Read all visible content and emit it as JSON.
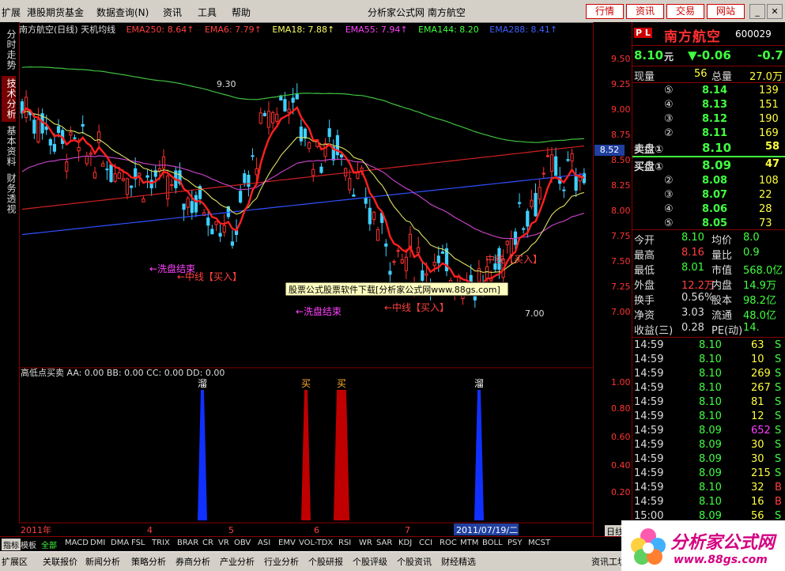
{
  "menu": {
    "items": [
      "扩展",
      "港股期货基金",
      "数据查询(N)",
      "资讯",
      "工具",
      "帮助"
    ],
    "title": "分析家公式网  南方航空",
    "buttons": [
      "行情",
      "资讯",
      "交易",
      "网站"
    ]
  },
  "side_tabs": [
    "分时走势",
    "技术分析",
    "基本资料",
    "财务透视"
  ],
  "indicator_line": {
    "prefix": "南方航空(日线) 天机均线",
    "emas": [
      {
        "label": "EMA250: 8.64↑",
        "color": "#ff4040"
      },
      {
        "label": "EMA6: 7.79↑",
        "color": "#ff4040"
      },
      {
        "label": "EMA18: 7.88↑",
        "color": "#ffff60"
      },
      {
        "label": "EMA55: 7.94↑",
        "color": "#ff40ff"
      },
      {
        "label": "EMA144: 8.20",
        "color": "#40ff40"
      },
      {
        "label": "EMA288: 8.41↑",
        "color": "#4060ff"
      }
    ]
  },
  "price_axis": [
    "9.50",
    "9.25",
    "9.00",
    "8.75",
    "8.50",
    "8.25",
    "8.00",
    "7.75",
    "7.50",
    "7.25",
    "7.00"
  ],
  "current_price_tag": "8.52",
  "annotations": {
    "high": "9.30",
    "low": "7.00",
    "wash1": "←洗盘结束",
    "wash2": "←洗盘结束",
    "buy1": "←中线【买入】",
    "buy2": "←中线【买入】",
    "buy3": "中线【买入】",
    "watermark": "股票公式股票软件下载[分析家公式网www.88gs.com]"
  },
  "lower_panel": {
    "title": "高低点买卖 AA: 0.00 BB: 0.00 CC: 0.00 DD: 0.00",
    "axis": [
      "1.00",
      "0.80",
      "0.60",
      "0.40",
      "0.20"
    ],
    "signals": [
      "溜",
      "买",
      "买",
      "溜"
    ]
  },
  "chart_data": {
    "type": "bar",
    "x_labels": [
      "2011年",
      "4",
      "5",
      "6",
      "7",
      "2011/07/19/二"
    ],
    "signal_bars": [
      {
        "label": "溜",
        "value": 1.0,
        "color": "#1030ff"
      },
      {
        "label": "买",
        "value": 1.0,
        "color": "#c00000"
      },
      {
        "label": "买",
        "value": 1.0,
        "color": "#c00000"
      },
      {
        "label": "溜",
        "value": 1.0,
        "color": "#1030ff"
      }
    ],
    "ylim": [
      0,
      1.0
    ]
  },
  "right_panel": {
    "logo": "P L",
    "name": "南方航空",
    "code": "600029",
    "price": "8.10",
    "price_unit": "元",
    "change": "▼-0.06",
    "change2": "-0.7",
    "volume_now_label": "现量",
    "volume_now": "56",
    "volume_total_label": "总量",
    "volume_total": "27.0万",
    "sell_levels": [
      {
        "lvl": "⑤",
        "price": "8.14",
        "vol": "139"
      },
      {
        "lvl": "④",
        "price": "8.13",
        "vol": "151"
      },
      {
        "lvl": "③",
        "price": "8.12",
        "vol": "190"
      },
      {
        "lvl": "②",
        "price": "8.11",
        "vol": "169"
      }
    ],
    "ask1": {
      "label": "卖盘①",
      "price": "8.10",
      "vol": "58"
    },
    "bid1": {
      "label": "买盘①",
      "price": "8.09",
      "vol": "47"
    },
    "buy_levels": [
      {
        "lvl": "②",
        "price": "8.08",
        "vol": "108"
      },
      {
        "lvl": "③",
        "price": "8.07",
        "vol": "22"
      },
      {
        "lvl": "④",
        "price": "8.06",
        "vol": "28"
      },
      {
        "lvl": "⑤",
        "price": "8.05",
        "vol": "73"
      }
    ],
    "stats": [
      {
        "a": "今开",
        "b": "8.10",
        "c": "均价",
        "d": "8.0"
      },
      {
        "a": "最高",
        "b": "8.16",
        "c": "量比",
        "d": "0.9"
      },
      {
        "a": "最低",
        "b": "8.01",
        "c": "市值",
        "d": "568.0亿"
      },
      {
        "a": "外盘",
        "b": "12.2万",
        "c": "内盘",
        "d": "14.9万"
      },
      {
        "a": "换手",
        "b": "0.56%",
        "c": "股本",
        "d": "98.2亿"
      },
      {
        "a": "净资",
        "b": "3.03",
        "c": "流通",
        "d": "48.0亿"
      },
      {
        "a": "收益(三)",
        "b": "0.28",
        "c": "PE(动)",
        "d": "14."
      }
    ],
    "ticks": [
      {
        "t": "14:59",
        "p": "8.10",
        "v": "63",
        "s": "S"
      },
      {
        "t": "14:59",
        "p": "8.10",
        "v": "10",
        "s": "S"
      },
      {
        "t": "14:59",
        "p": "8.10",
        "v": "269",
        "s": "S"
      },
      {
        "t": "14:59",
        "p": "8.10",
        "v": "267",
        "s": "S"
      },
      {
        "t": "14:59",
        "p": "8.10",
        "v": "81",
        "s": "S"
      },
      {
        "t": "14:59",
        "p": "8.10",
        "v": "12",
        "s": "S"
      },
      {
        "t": "14:59",
        "p": "8.09",
        "v": "652",
        "s": "S"
      },
      {
        "t": "14:59",
        "p": "8.09",
        "v": "30",
        "s": "S"
      },
      {
        "t": "14:59",
        "p": "8.09",
        "v": "30",
        "s": "S"
      },
      {
        "t": "14:59",
        "p": "8.09",
        "v": "215",
        "s": "S"
      },
      {
        "t": "14:59",
        "p": "8.10",
        "v": "32",
        "s": "B"
      },
      {
        "t": "14:59",
        "p": "8.10",
        "v": "16",
        "s": "B"
      },
      {
        "t": "15:00",
        "p": "8.09",
        "v": "56",
        "s": "S"
      }
    ]
  },
  "bottom": {
    "period": "日线",
    "indicator_tabs": [
      "指标",
      "模板",
      "全部",
      "MACD",
      "DMI",
      "DMA",
      "FSL",
      "TRIX",
      "BRAR",
      "CR",
      "VR",
      "OBV",
      "ASI",
      "EMV",
      "VOL-TDX",
      "RSI",
      "WR",
      "SAR",
      "KDJ",
      "CCI",
      "ROC",
      "MTM",
      "BOLL",
      "PSY",
      "MCST"
    ],
    "nav": [
      "扩展区",
      "关联报价",
      "新闻分析",
      "策略分析",
      "券商分析",
      "产业分析",
      "行业分析",
      "个股研报",
      "个股评级",
      "个股资讯",
      "财经精选",
      "资讯工坊"
    ],
    "logo_text": "分析家公式网",
    "logo_url": "www.88gs.com"
  }
}
